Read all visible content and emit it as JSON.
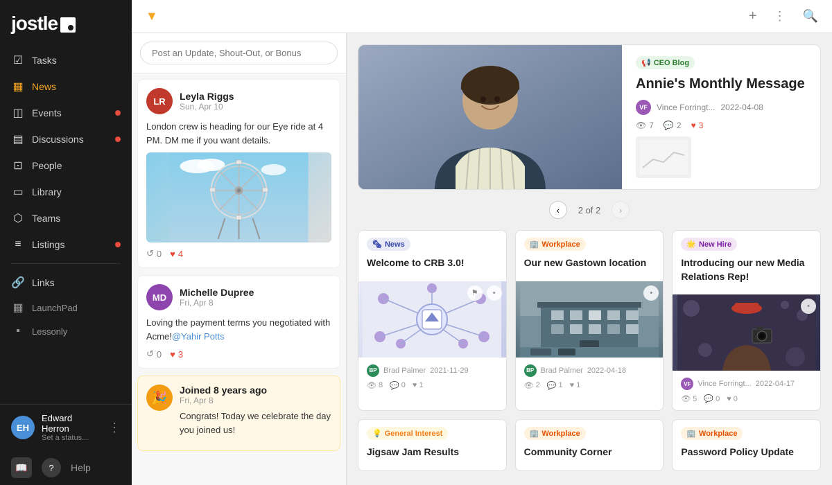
{
  "app": {
    "name": "jostle",
    "logo_icon": "□"
  },
  "sidebar": {
    "nav_items": [
      {
        "id": "tasks",
        "label": "Tasks",
        "icon": "✓",
        "active": false,
        "badge": false
      },
      {
        "id": "news",
        "label": "News",
        "icon": "📰",
        "active": true,
        "badge": false
      },
      {
        "id": "events",
        "label": "Events",
        "icon": "📅",
        "active": false,
        "badge": true
      },
      {
        "id": "discussions",
        "label": "Discussions",
        "icon": "💬",
        "active": false,
        "badge": true
      },
      {
        "id": "people",
        "label": "People",
        "icon": "👤",
        "active": false,
        "badge": false
      },
      {
        "id": "library",
        "label": "Library",
        "icon": "📚",
        "active": false,
        "badge": false
      },
      {
        "id": "teams",
        "label": "Teams",
        "icon": "⬡",
        "active": false,
        "badge": false
      },
      {
        "id": "listings",
        "label": "Listings",
        "icon": "≡",
        "active": false,
        "badge": true
      }
    ],
    "links_label": "Links",
    "launchpad_label": "LaunchPad",
    "lessonly_label": "Lessonly",
    "user": {
      "name": "Edward Herron",
      "status": "Set a status...",
      "initials": "EH"
    },
    "help_label": "Help"
  },
  "topbar": {
    "filter_icon": "▼",
    "add_icon": "+",
    "more_icon": "⋮",
    "search_icon": "🔍"
  },
  "feed": {
    "input_placeholder": "Post an Update, Shout-Out, or Bonus",
    "posts": [
      {
        "id": "post1",
        "author": "Leyla Riggs",
        "date": "Sun, Apr 10",
        "text": "London crew is heading for our Eye ride at 4 PM. DM me if you want details.",
        "has_image": true,
        "replies": 0,
        "likes": 4,
        "initials": "LR",
        "color": "#c0392b"
      },
      {
        "id": "post2",
        "author": "Michelle Dupree",
        "date": "Fri, Apr 8",
        "text": "Loving the payment terms you negotiated with Acme!",
        "mention": "@Yahir Potts",
        "has_image": false,
        "replies": 0,
        "likes": 3,
        "initials": "MD",
        "color": "#8e44ad"
      },
      {
        "id": "post3",
        "author": "Joined 8 years ago",
        "date": "Fri, Apr 8",
        "text": "Congrats! Today we celebrate the day you joined us!",
        "is_anniversary": true,
        "initials": "🎉"
      }
    ]
  },
  "featured": {
    "tag": "CEO Blog",
    "tag_emoji": "📢",
    "title": "Annie's Monthly Message",
    "author": "Vince Forringt...",
    "date": "2022-04-08",
    "views": 7,
    "comments": 2,
    "likes": 3,
    "page_current": "2 of 2"
  },
  "news_cards": [
    {
      "id": "card1",
      "tag": "News",
      "tag_emoji": "🗞",
      "tag_class": "tag-news",
      "title": "Welcome to CRB 3.0!",
      "image_type": "network",
      "author": "Brad Palmer",
      "date": "2021-11-29",
      "views": 8,
      "comments": 0,
      "likes": 1,
      "author_color": "#2c8c5a",
      "author_initials": "BP"
    },
    {
      "id": "card2",
      "tag": "Workplace",
      "tag_emoji": "🏢",
      "tag_class": "tag-workplace",
      "title": "Our new Gastown location",
      "image_type": "building",
      "author": "Brad Palmer",
      "date": "2022-04-18",
      "views": 2,
      "comments": 1,
      "likes": 1,
      "author_color": "#2c8c5a",
      "author_initials": "BP"
    },
    {
      "id": "card3",
      "tag": "New Hire",
      "tag_emoji": "🌟",
      "tag_class": "tag-newhire",
      "title": "Introducing our new Media Relations Rep!",
      "image_type": "photographer",
      "author": "Vince Forringt...",
      "date": "2022-04-17",
      "views": 5,
      "comments": 0,
      "likes": 0,
      "author_color": "#9b59b6",
      "author_initials": "VF"
    }
  ],
  "news_cards_bottom": [
    {
      "id": "bottom1",
      "tag": "General Interest",
      "tag_emoji": "💡",
      "tag_class": "tag-general",
      "title": "Jigsaw Jam Results"
    },
    {
      "id": "bottom2",
      "tag": "Workplace",
      "tag_emoji": "🏢",
      "tag_class": "tag-workplace",
      "title": "Community Corner"
    },
    {
      "id": "bottom3",
      "tag": "Workplace",
      "tag_emoji": "🏢",
      "tag_class": "tag-workplace",
      "title": "Password Policy Update"
    }
  ]
}
